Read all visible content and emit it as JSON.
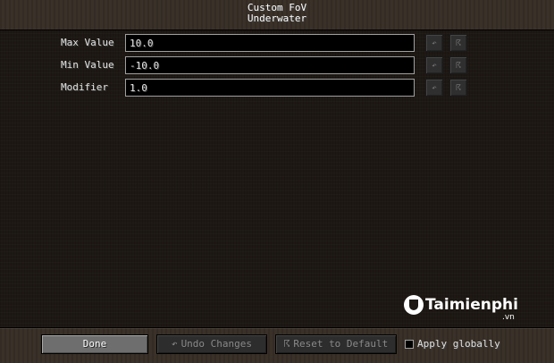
{
  "header": {
    "title": "Custom FoV",
    "subtitle": "Underwater"
  },
  "settings": [
    {
      "label": "Max Value",
      "value": "10.0",
      "undo_icon": "undo-arrow-icon",
      "reset_icon": "reset-icon"
    },
    {
      "label": "Min Value",
      "value": "-10.0",
      "undo_icon": "undo-arrow-icon",
      "reset_icon": "reset-icon"
    },
    {
      "label": "Modifier",
      "value": "1.0",
      "undo_icon": "undo-arrow-icon",
      "reset_icon": "reset-icon"
    }
  ],
  "row_buttons": {
    "undo_glyph": "↶",
    "reset_glyph": "☈"
  },
  "footer": {
    "done_label": "Done",
    "undo_label": "Undo Changes",
    "undo_glyph": "↶",
    "reset_label": "Reset to Default",
    "reset_glyph": "☈",
    "apply_globally_label": "Apply globally",
    "apply_globally_checked": false
  },
  "watermark": {
    "text": "Taimienphi",
    "suffix": ".vn"
  }
}
